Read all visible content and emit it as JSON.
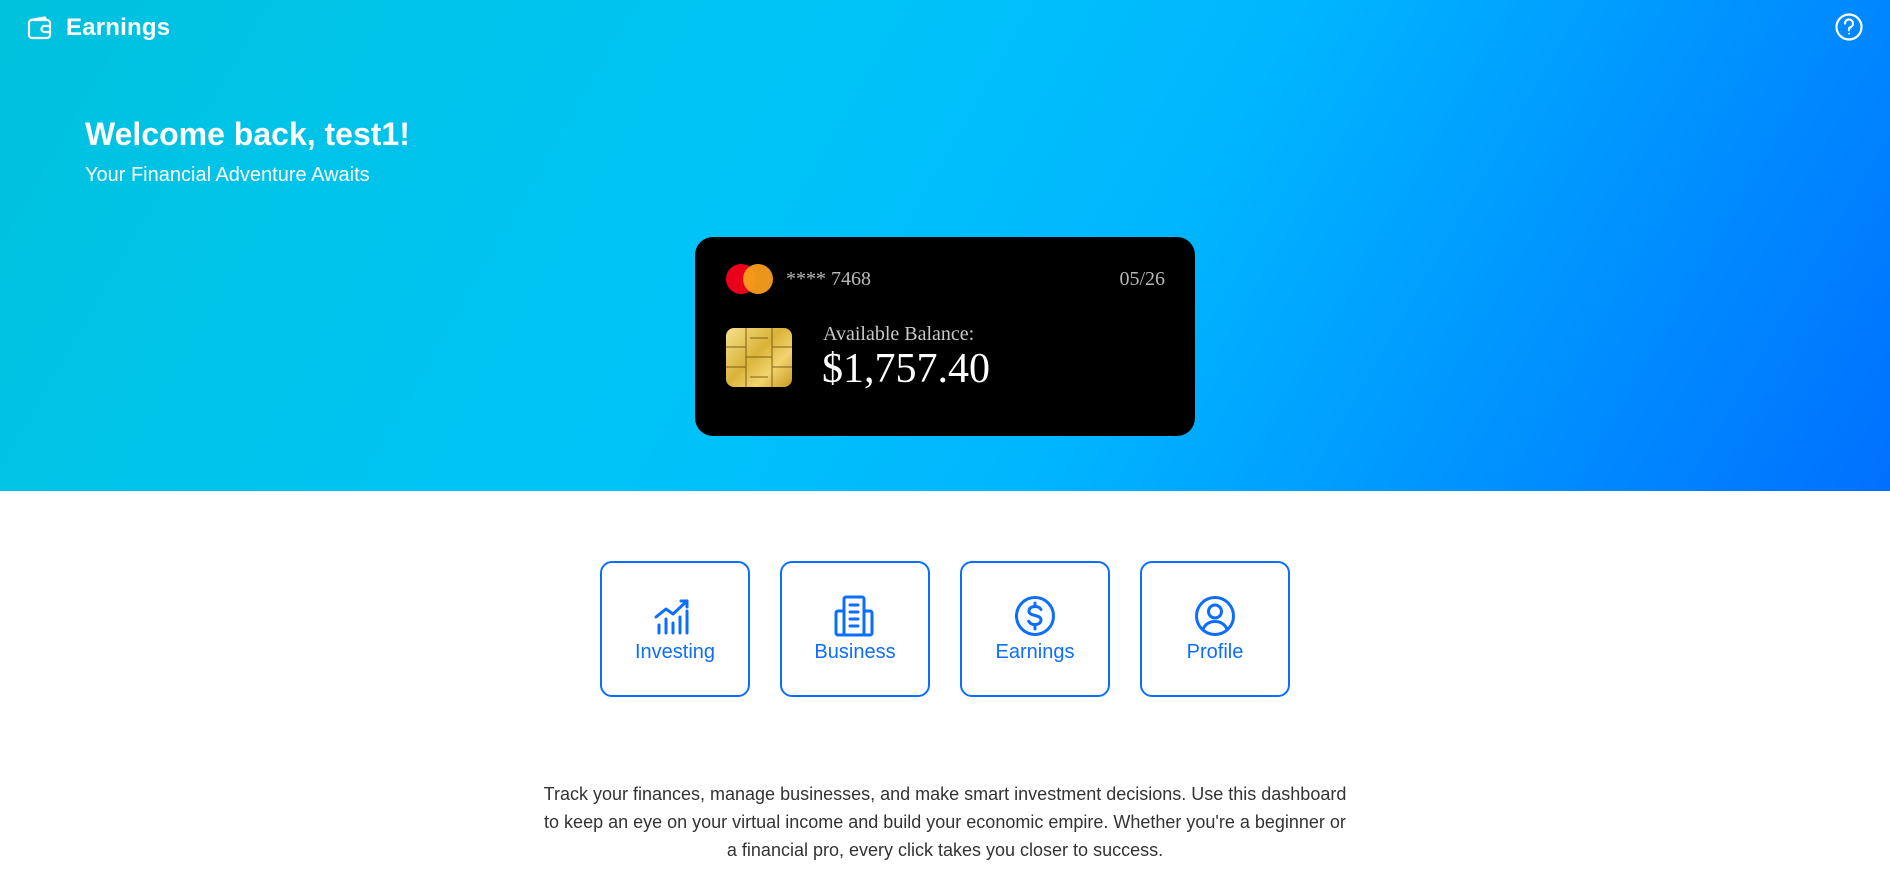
{
  "header": {
    "title": "Earnings",
    "brand_icon": "wallet-icon",
    "help_icon": "question-circle-icon"
  },
  "hero": {
    "welcome": "Welcome back, test1!",
    "subtitle": "Your Financial Adventure Awaits"
  },
  "card": {
    "brand_icon": "mastercard-logo",
    "number": "**** 7468",
    "expiry": "05/26",
    "balance_label": "Available Balance:",
    "balance": "$1,757.40"
  },
  "nav": [
    {
      "label": "Investing",
      "icon": "chart-icon"
    },
    {
      "label": "Business",
      "icon": "building-icon"
    },
    {
      "label": "Earnings",
      "icon": "dollar-circle-icon"
    },
    {
      "label": "Profile",
      "icon": "user-circle-icon"
    }
  ],
  "description": "Track your finances, manage businesses, and make smart investment decisions. Use this dashboard to keep an eye on your virtual income and build your economic empire. Whether you're a beginner or a financial pro, every click takes you closer to success.",
  "colors": {
    "accent": "#0d6efd",
    "card_bg": "#000000",
    "hero_start": "#00c2dc",
    "hero_end": "#0070ff"
  }
}
